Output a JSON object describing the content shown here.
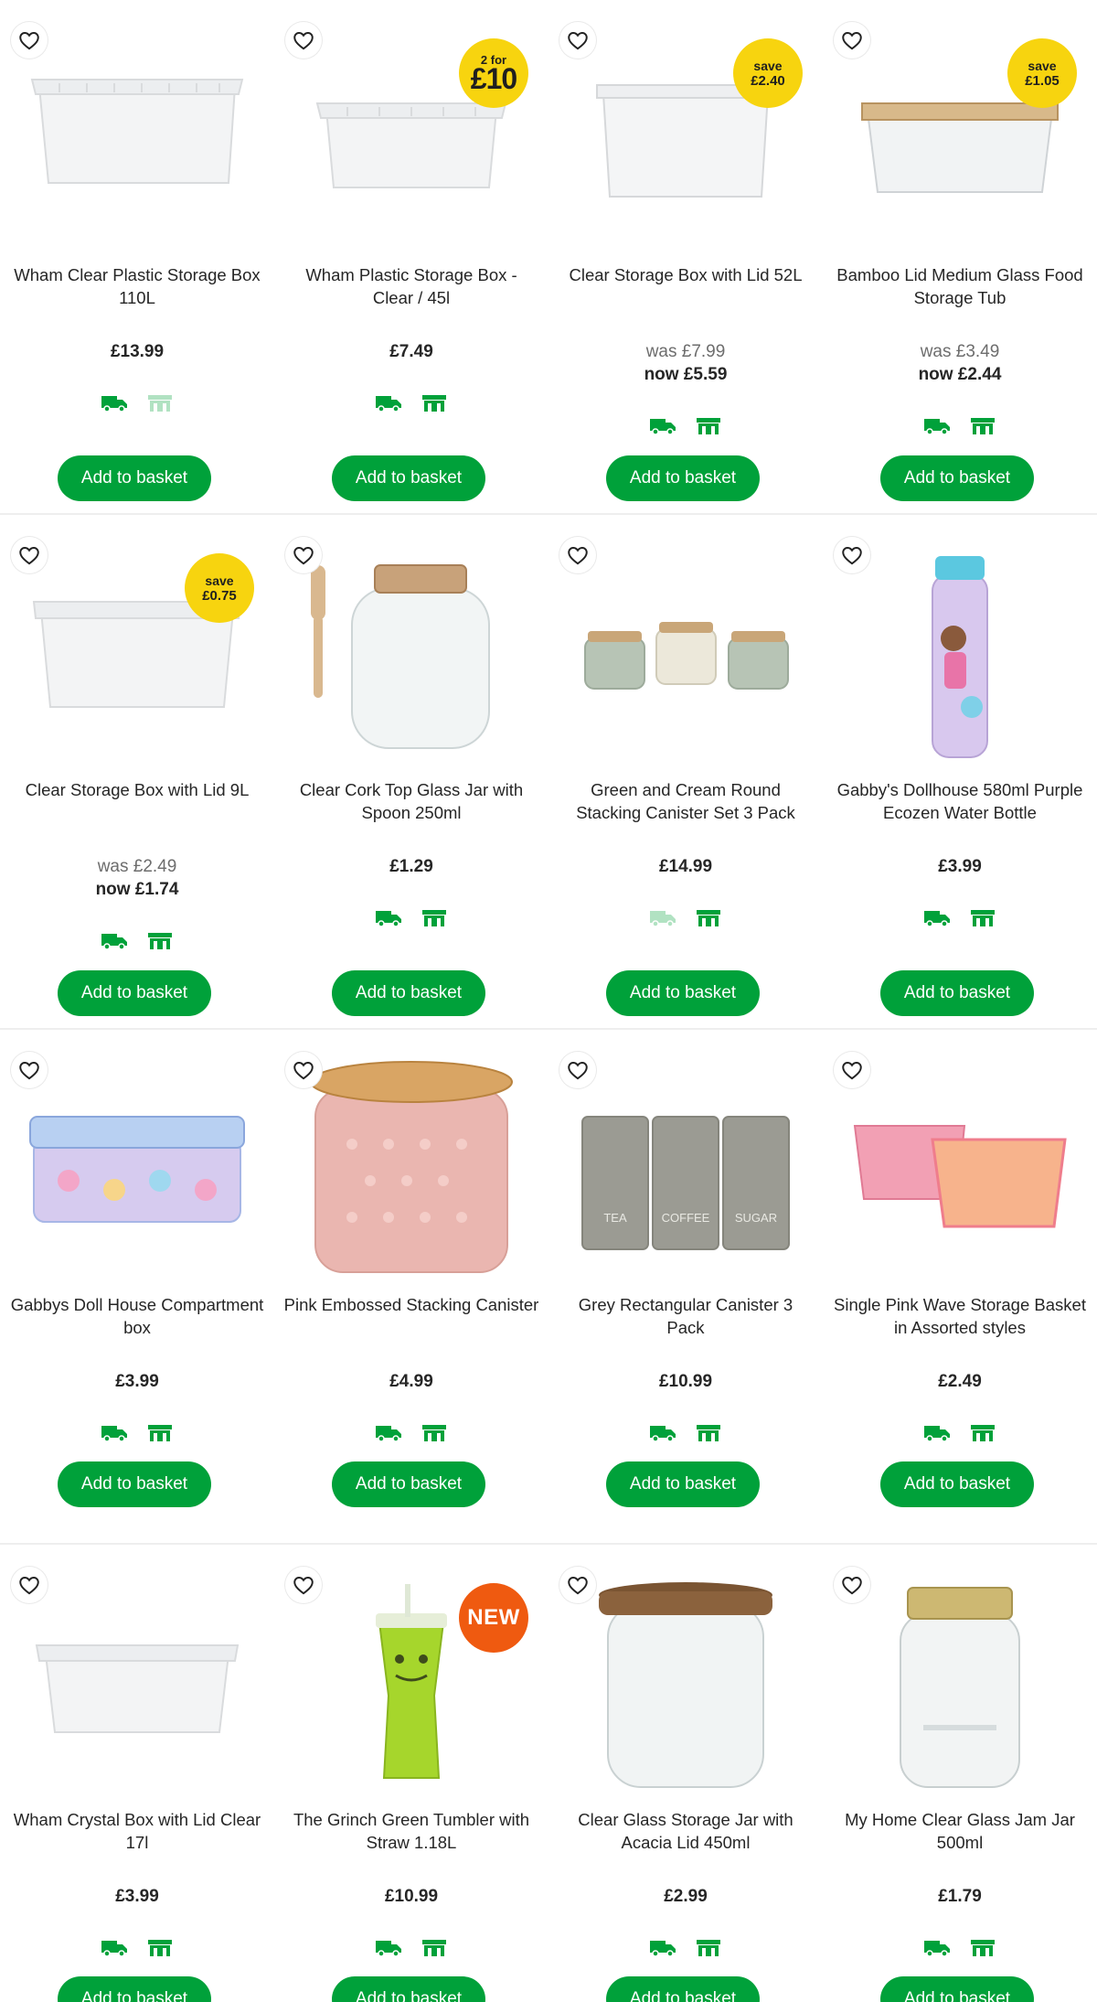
{
  "colors": {
    "accent_green": "#00a13a",
    "badge_yellow": "#f7d40f",
    "badge_new_orange": "#ef5a10"
  },
  "icons": {
    "wishlist": "heart-outline-icon",
    "delivery": "delivery-van-icon",
    "collect": "store-collect-icon"
  },
  "products": [
    {
      "title": "Wham Clear Plastic Storage Box 110L",
      "price": "£13.99",
      "badge": null,
      "delivery_available": true,
      "collect_available": false,
      "button": "Add to basket"
    },
    {
      "title": "Wham Plastic Storage Box - Clear / 45l",
      "price": "£7.49",
      "badge": {
        "line1": "2 for",
        "line2": "£10"
      },
      "delivery_available": true,
      "collect_available": true,
      "button": "Add to basket"
    },
    {
      "title": "Clear Storage Box with Lid 52L",
      "was": "was £7.99",
      "now": "now £5.59",
      "badge": {
        "line1": "save",
        "line2": "£2.40"
      },
      "delivery_available": true,
      "collect_available": true,
      "button": "Add to basket"
    },
    {
      "title": "Bamboo Lid Medium Glass Food Storage Tub",
      "was": "was £3.49",
      "now": "now £2.44",
      "badge": {
        "line1": "save",
        "line2": "£1.05"
      },
      "delivery_available": true,
      "collect_available": true,
      "button": "Add to basket"
    },
    {
      "title": "Clear Storage Box with Lid 9L",
      "was": "was £2.49",
      "now": "now £1.74",
      "badge": {
        "line1": "save",
        "line2": "£0.75"
      },
      "delivery_available": true,
      "collect_available": true,
      "button": "Add to basket"
    },
    {
      "title": "Clear Cork Top Glass Jar with Spoon 250ml",
      "price": "£1.29",
      "badge": null,
      "delivery_available": true,
      "collect_available": true,
      "button": "Add to basket"
    },
    {
      "title": "Green and Cream Round Stacking Canister Set 3 Pack",
      "price": "£14.99",
      "badge": null,
      "delivery_available": false,
      "collect_available": true,
      "button": "Add to basket"
    },
    {
      "title": "Gabby's Dollhouse 580ml Purple Ecozen Water Bottle",
      "price": "£3.99",
      "badge": null,
      "delivery_available": true,
      "collect_available": true,
      "button": "Add to basket"
    },
    {
      "title": "Gabbys Doll House Compartment box",
      "price": "£3.99",
      "badge": null,
      "delivery_available": true,
      "collect_available": true,
      "button": "Add to basket"
    },
    {
      "title": "Pink Embossed Stacking Canister",
      "price": "£4.99",
      "badge": null,
      "delivery_available": true,
      "collect_available": true,
      "button": "Add to basket"
    },
    {
      "title": "Grey Rectangular Canister 3 Pack",
      "price": "£10.99",
      "badge": null,
      "delivery_available": true,
      "collect_available": true,
      "button": "Add to basket",
      "image_labels": [
        "TEA",
        "COFFEE",
        "SUGAR"
      ]
    },
    {
      "title": "Single Pink Wave Storage Basket in Assorted styles",
      "price": "£2.49",
      "badge": null,
      "delivery_available": true,
      "collect_available": true,
      "button": "Add to basket"
    },
    {
      "title": "Wham Crystal Box with Lid Clear 17l",
      "price": "£3.99",
      "badge": null,
      "delivery_available": true,
      "collect_available": true,
      "button": "Add to basket"
    },
    {
      "title": "The Grinch Green Tumbler with Straw 1.18L",
      "price": "£10.99",
      "badge": {
        "line1": "NEW"
      },
      "delivery_available": true,
      "collect_available": true,
      "button": "Add to basket"
    },
    {
      "title": "Clear Glass Storage Jar with Acacia Lid 450ml",
      "price": "£2.99",
      "badge": null,
      "delivery_available": true,
      "collect_available": true,
      "button": "Add to basket"
    },
    {
      "title": "My Home Clear Glass Jam Jar 500ml",
      "price": "£1.79",
      "badge": null,
      "delivery_available": true,
      "collect_available": true,
      "button": "Add to basket"
    }
  ]
}
